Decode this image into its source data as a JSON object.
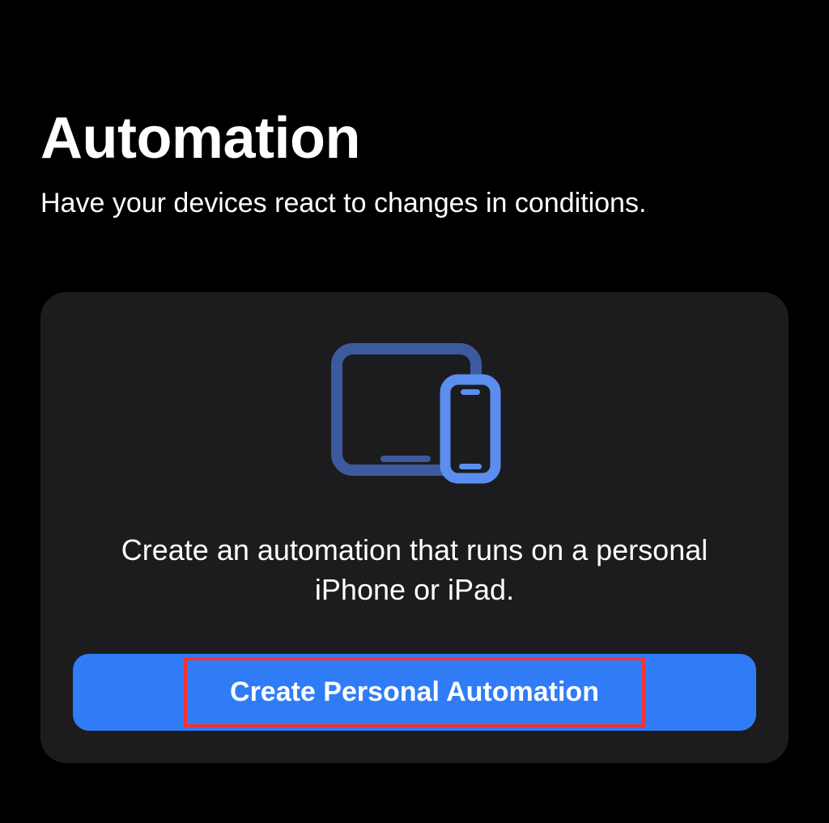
{
  "header": {
    "title": "Automation",
    "subtitle": "Have your devices react to changes in conditions."
  },
  "card": {
    "icon_name": "devices-icon",
    "description": "Create an automation that runs on a personal iPhone or iPad.",
    "button_label": "Create Personal Automation"
  },
  "colors": {
    "background": "#000000",
    "card_background": "#1c1c1e",
    "accent": "#2f7cf6",
    "icon_primary": "#5c8ef0",
    "icon_secondary": "#3d5a9e",
    "highlight": "#ff3030"
  }
}
